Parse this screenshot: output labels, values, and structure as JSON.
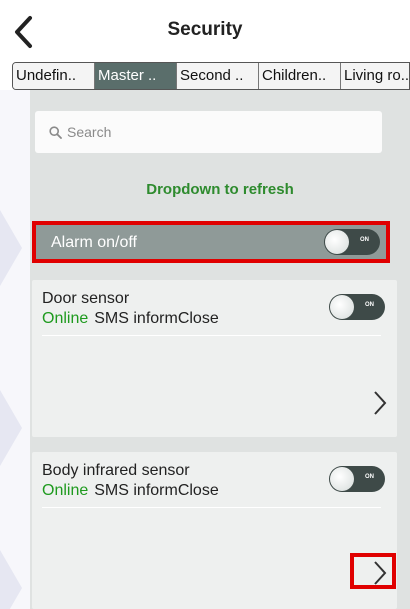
{
  "header": {
    "title": "Security"
  },
  "tabs": [
    {
      "label": "Undefin..",
      "active": false
    },
    {
      "label": "Master ..",
      "active": true
    },
    {
      "label": "Second ..",
      "active": false
    },
    {
      "label": "Children..",
      "active": false
    },
    {
      "label": "Living ro..",
      "active": false
    }
  ],
  "search": {
    "placeholder": "Search"
  },
  "refresh_label": "Dropdown to refresh",
  "alarm": {
    "label": "Alarm on/off",
    "toggle_text": "ON"
  },
  "devices": [
    {
      "name": "Door sensor",
      "status": "Online",
      "info": "SMS informClose",
      "toggle_text": "ON"
    },
    {
      "name": "Body infrared sensor",
      "status": "Online",
      "info": "SMS informClose",
      "toggle_text": "ON"
    }
  ],
  "colors": {
    "accent_green": "#2e8b2e",
    "highlight_red": "#e00000",
    "active_tab": "#5a6e6b"
  }
}
